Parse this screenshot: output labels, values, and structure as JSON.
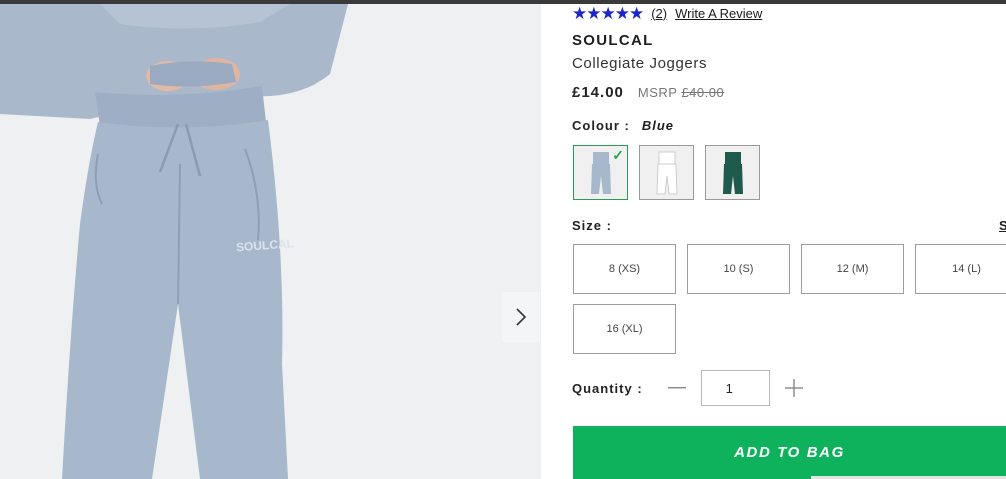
{
  "rating": {
    "stars": "★★★★★",
    "count": "(2)",
    "write_review": "Write A Review",
    "value": 4.5
  },
  "product": {
    "brand": "SOULCAL",
    "name": "Collegiate Joggers",
    "price": "£14.00",
    "msrp_label": "MSRP",
    "original_price": "£40.00"
  },
  "colour": {
    "label": "Colour :",
    "selected": "Blue",
    "swatches": [
      {
        "name": "Blue",
        "color": "#a8b8cc",
        "selected": true
      },
      {
        "name": "White",
        "color": "#eeeeee",
        "selected": false
      },
      {
        "name": "Green",
        "color": "#1f5b4c",
        "selected": false
      }
    ]
  },
  "size": {
    "label": "Size :",
    "guide": "S",
    "options": [
      "8 (XS)",
      "10 (S)",
      "12 (M)",
      "14 (L)",
      "16 (XL)"
    ]
  },
  "quantity": {
    "label": "Quantity :",
    "value": "1"
  },
  "add_to_bag": "ADD TO BAG",
  "gallery": {
    "logo_text": "SOULCAL"
  },
  "colors": {
    "accent_green": "#0fb25c",
    "star_blue": "#1d27c9",
    "jogger_blue": "#a7b8cc"
  }
}
